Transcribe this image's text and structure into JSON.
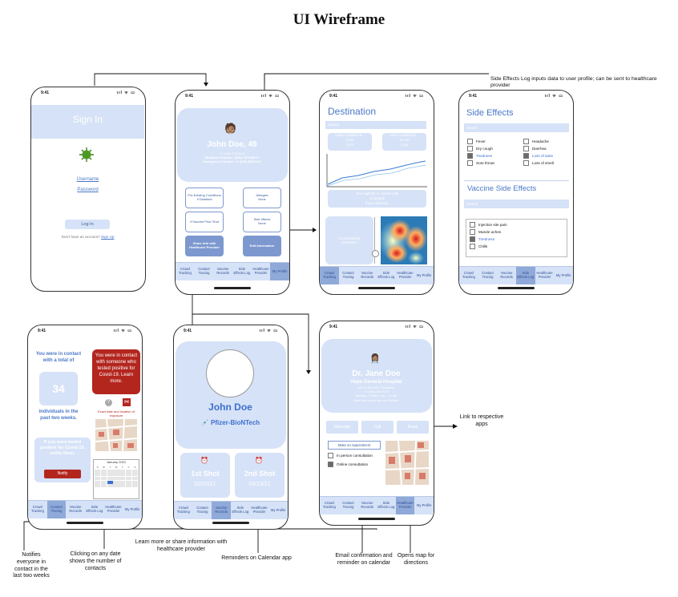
{
  "title": "UI Wireframe",
  "time": "9:41",
  "signals": "ııl ᯤ ▭",
  "nav": [
    "Crowd Tracking",
    "Contact Tracing",
    "Vaccine Records",
    "Side Effects Log",
    "Healthcare Provider",
    "My Profile"
  ],
  "signin": {
    "header": "Sign In",
    "virus_icon": "virus-icon",
    "username": "Username",
    "password": "Password",
    "login": "Log In",
    "no_account": "Don't have an account?",
    "signup": "Sign Up"
  },
  "profile": {
    "name": "John Doe, 49",
    "phone": "+1 (215) 778 3432",
    "medicare": "Medicare Number: 1EG4-TE5-MK72",
    "emergency": "Emergency Contact: +1 (215) 558 9121",
    "preexisting": "Pre-Existing Conditions",
    "preexisting_val": "Diabetes",
    "allergies": "Allergies",
    "allergies_val": "None",
    "vaccine_prior": "Vaccine Prior Shot",
    "side_effects": "Side effects",
    "side_effects_val": "None",
    "share": "Share Info with Healthcare Provider",
    "edit": "Edit Information"
  },
  "destination": {
    "header": "Destination",
    "search": "Search",
    "card1": "Least crowded at...",
    "card1_a": "2 pm",
    "card1_b": "4 pm",
    "card2": "Most crowded at...",
    "card2_a": "12 pm",
    "card2_b": "1 pm",
    "contact": "You might be in contact with",
    "contact_b": "10 people",
    "contact_c": "if you visit now.",
    "density": "Crowd Density Saturation"
  },
  "sidefx": {
    "header": "Side Effects",
    "search": "Search",
    "col1": [
      {
        "label": "Fever",
        "on": false
      },
      {
        "label": "Dry cough",
        "on": false
      },
      {
        "label": "Tiredness",
        "on": true
      },
      {
        "label": "Sore throat",
        "on": false
      }
    ],
    "col2": [
      {
        "label": "Headache",
        "on": false
      },
      {
        "label": "Diarrhea",
        "on": false
      },
      {
        "label": "Loss of taste",
        "on": true
      },
      {
        "label": "Loss of smell",
        "on": false
      }
    ],
    "vheader": "Vaccine Side Effects",
    "vsearch": "Search",
    "vlist": [
      {
        "label": "Injection site pain",
        "on": false
      },
      {
        "label": "Muscle aches",
        "on": false
      },
      {
        "label": "Tiredness",
        "on": true
      },
      {
        "label": "Chills",
        "on": false
      }
    ]
  },
  "contact": {
    "line1": "You were in contact with a total of",
    "count": "34",
    "line2": "individuals in the past two weeks.",
    "alert": "You were in contact with someone who tested positive for Covid-19. Learn more.",
    "exact": "Exact date and location of exposure",
    "positive": "If you were tested positive for Covid-19, notify them.",
    "notify": "Notify",
    "calendar_title": "January 2021",
    "week": [
      "S",
      "M",
      "T",
      "W",
      "T",
      "F",
      "S"
    ]
  },
  "records": {
    "name": "John Doe",
    "vaccine": "Pfizer-BioNTech",
    "shot1": "1st Shot",
    "date1": "02/20/21",
    "shot2": "2nd Shot",
    "date2": "03/13/21"
  },
  "doctor": {
    "name": "Dr. Jane Doe",
    "hospital": "Hope General Hospital",
    "addr": "88 W Lake Ave, Pasadena",
    "phone": "+1 (626) 188 3743",
    "hours": "Monday - Friday, 9 am - 11 am",
    "badges": "Does this consult  Can see Provider",
    "message": "Message",
    "call": "Call",
    "email": "Email",
    "appointment": "Make an Appointment",
    "inperson": "In person consultation",
    "online": "Online consultation"
  },
  "notes": {
    "sidefx_note": "Side Effects Log inputs data to user profile; can be sent to healthcare provider",
    "link": "Link to respective apps",
    "notifies": "Notifies everyone in contact in the last two weeks",
    "clicking": "Clicking on any date shows the number of contacts",
    "learn": "Learn more or share information with healthcare provider",
    "reminders": "Reminders on Calendar app",
    "email_conf": "Email confirmation and reminder on calendar",
    "opens_map": "Opens map for directions"
  },
  "colors": {
    "accent": "#4a78c8",
    "panel": "#d6e2f7",
    "alert": "#b3261e"
  }
}
